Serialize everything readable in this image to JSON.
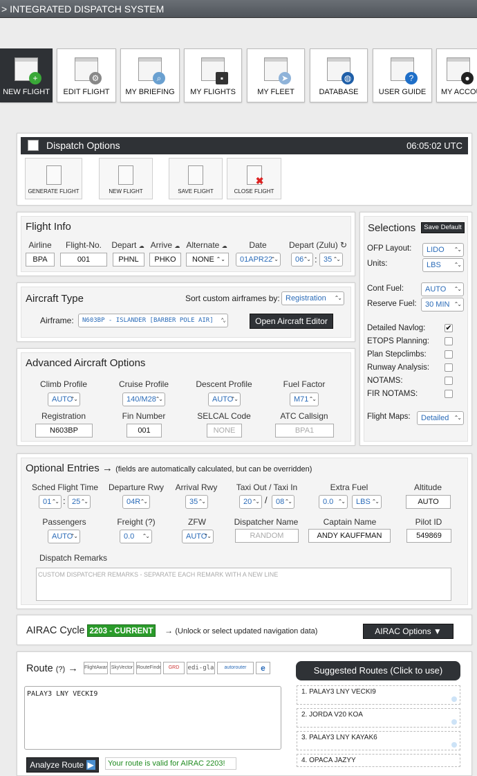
{
  "topbar": {
    "title": "> INTEGRATED DISPATCH SYSTEM"
  },
  "nav": [
    {
      "label": "NEW FLIGHT"
    },
    {
      "label": "EDIT FLIGHT"
    },
    {
      "label": "MY BRIEFING"
    },
    {
      "label": "MY FLIGHTS"
    },
    {
      "label": "MY FLEET"
    },
    {
      "label": "DATABASE"
    },
    {
      "label": "USER GUIDE"
    },
    {
      "label": "MY ACCOUNT"
    }
  ],
  "dispatch": {
    "title": "Dispatch Options",
    "time": "06:05:02 UTC",
    "buttons": [
      "GENERATE FLIGHT",
      "NEW FLIGHT",
      "SAVE FLIGHT",
      "CLOSE FLIGHT"
    ]
  },
  "flightinfo": {
    "title": "Flight Info",
    "labels": {
      "airline": "Airline",
      "flightno": "Flight-No.",
      "depart": "Depart",
      "arrive": "Arrive",
      "alternate": "Alternate",
      "date": "Date",
      "departzulu": "Depart (Zulu)"
    },
    "values": {
      "airline": "BPA",
      "flightno": "001",
      "depart": "PHNL",
      "arrive": "PHKO",
      "alternate": "NONE",
      "date": "01APR22",
      "hh": "06",
      "mm": "35"
    },
    "colon": ":"
  },
  "aircraft": {
    "title": "Aircraft Type",
    "sort_label": "Sort custom airframes by:",
    "sort_value": "Registration",
    "airframe_label": "Airframe:",
    "airframe_value": "N603BP - ISLANDER [BARBER POLE AIR]",
    "editor_button": "Open Aircraft Editor"
  },
  "adv": {
    "title": "Advanced Aircraft Options",
    "labels": {
      "climb": "Climb Profile",
      "cruise": "Cruise Profile",
      "descent": "Descent Profile",
      "fuelfactor": "Fuel Factor",
      "registration": "Registration",
      "fin": "Fin Number",
      "selcal": "SELCAL Code",
      "atc": "ATC Callsign"
    },
    "values": {
      "climb": "AUTO",
      "cruise": "140/M28",
      "descent": "AUTO",
      "fuelfactor": "M71",
      "registration": "N603BP",
      "fin": "001",
      "selcal": "NONE",
      "atc": "BPA1"
    }
  },
  "selections": {
    "title": "Selections",
    "save_default": "Save Default",
    "ofp_label": "OFP Layout:",
    "ofp_value": "LIDO",
    "units_label": "Units:",
    "units_value": "LBS",
    "cont_label": "Cont Fuel:",
    "cont_value": "AUTO",
    "reserve_label": "Reserve Fuel:",
    "reserve_value": "30 MIN",
    "options": [
      {
        "label": "Detailed Navlog:",
        "mark": "✔"
      },
      {
        "label": "ETOPS Planning:",
        "mark": ""
      },
      {
        "label": "Plan Stepclimbs:",
        "mark": ""
      },
      {
        "label": "Runway Analysis:",
        "mark": ""
      },
      {
        "label": "NOTAMS:",
        "mark": ""
      },
      {
        "label": "FIR NOTAMS:",
        "mark": ""
      }
    ],
    "maps_label": "Flight Maps:",
    "maps_value": "Detailed"
  },
  "optional": {
    "title": "Optional Entries",
    "arrow": "→",
    "note": "(fields are automatically calculated, but can be overridden)",
    "labels": {
      "sched": "Sched Flight Time",
      "deprwy": "Departure Rwy",
      "arrrwy": "Arrival Rwy",
      "taxi": "Taxi Out / Taxi In",
      "extra": "Extra Fuel",
      "altitude": "Altitude",
      "pax": "Passengers",
      "freight": "Freight (?)",
      "zfw": "ZFW",
      "dispatcher": "Dispatcher Name",
      "captain": "Captain Name",
      "pilotid": "Pilot ID",
      "remarks": "Dispatch Remarks"
    },
    "values": {
      "sched_h": "01",
      "sched_m": "25",
      "deprwy": "04R",
      "arrrwy": "35",
      "taxiout": "20",
      "taxiin": "08",
      "extra": "0.0",
      "extra_unit": "LBS",
      "altitude": "AUTO",
      "pax": "AUTO",
      "freight": "0.0",
      "zfw": "AUTO",
      "dispatcher": "RANDOM",
      "captain": "ANDY KAUFFMAN",
      "pilotid": "549869",
      "remarks": "CUSTOM DISPATCHER REMARKS - SEPARATE EACH REMARK WITH A NEW LINE"
    },
    "colon": ":",
    "slash": "/"
  },
  "airac": {
    "title": "AIRAC Cycle",
    "badge": "2203 - CURRENT",
    "arrow": "→",
    "note": "(Unlock or select updated navigation data)",
    "button": "AIRAC Options ▼"
  },
  "route": {
    "title": "Route",
    "help": "(?)",
    "arrow": "→",
    "logos": [
      "FlightAware",
      "SkyVector",
      "RouteFinder",
      "GRD",
      "edi-gla",
      "autorouter",
      "e"
    ],
    "value": "PALAY3 LNY VECKI9",
    "analyze": "Analyze Route",
    "valid": "Your route is valid for AIRAC 2203!"
  },
  "suggested": {
    "title": "Suggested Routes (Click to use)",
    "items": [
      "1.  PALAY3 LNY VECKI9",
      "2.  JORDA V20 KOA",
      "3.  PALAY3 LNY KAYAK6",
      "4.  OPACA JAZYY"
    ]
  }
}
